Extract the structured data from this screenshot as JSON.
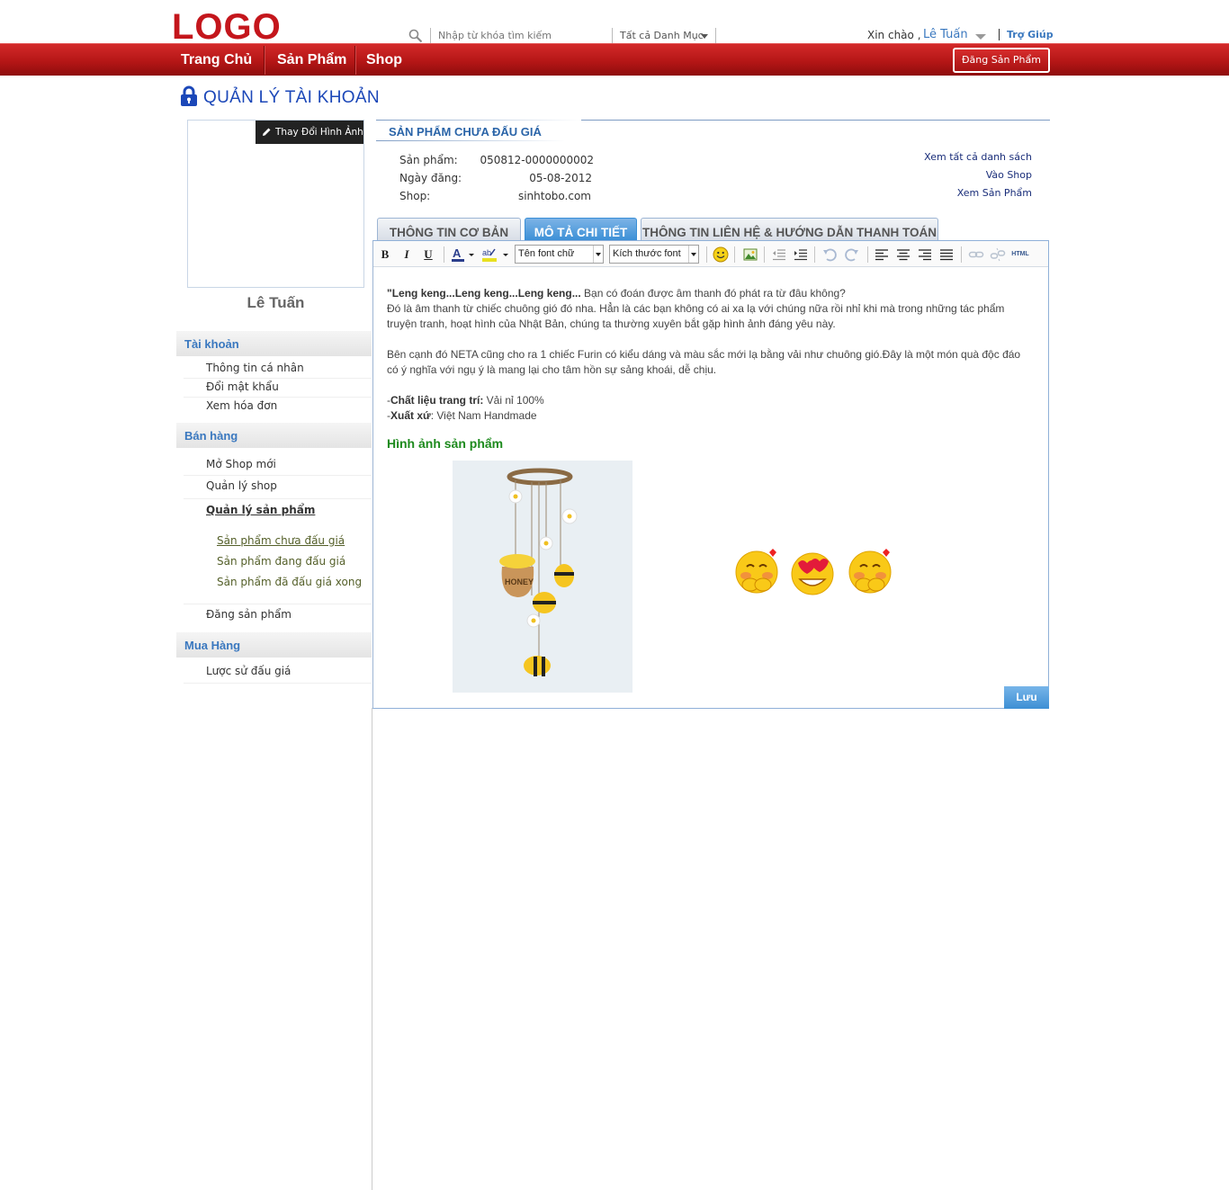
{
  "header": {
    "logo": "LOGO",
    "search_placeholder": "Nhập từ khóa tìm kiếm",
    "category": "Tất cả Danh Mục",
    "greeting": "Xin chào ,",
    "username": "Lê Tuấn",
    "help": "Trợ Giúp"
  },
  "nav": {
    "items": [
      "Trang Chủ",
      "Sản Phẩm",
      "Shop"
    ],
    "post_button": "Đăng Sản Phẩm"
  },
  "page_title": "QUẢN LÝ TÀI KHOẢN",
  "sidebar": {
    "change_photo": "Thay Đổi Hình Ảnh",
    "profile_name": "Lê Tuấn",
    "sections": [
      {
        "title": "Tài khoản",
        "items": [
          "Thông tin cá nhân",
          "Đổi mật khẩu",
          "Xem hóa đơn"
        ]
      },
      {
        "title": "Bán hàng",
        "items": [
          "Mở Shop mới",
          "Quản lý shop",
          "Quản lý sản phẩm",
          "Đăng sản phẩm"
        ],
        "subitems": [
          "Sản phẩm chưa đấu giá",
          "Sản phẩm đang đấu giá",
          "Sản phẩm đã đấu giá xong"
        ]
      },
      {
        "title": "Mua Hàng",
        "items": [
          "Lược sử đấu giá"
        ]
      }
    ]
  },
  "main": {
    "section_title": "SẢN PHẨM CHƯA ĐẤU GIÁ",
    "info": [
      {
        "label": "Sản phẩm:",
        "value": "050812-0000000002"
      },
      {
        "label": "Ngày đăng:",
        "value": "05-08-2012"
      },
      {
        "label": "Shop:",
        "value": "sinhtobo.com"
      }
    ],
    "links": [
      "Xem tất cả danh sách",
      "Vào Shop",
      "Xem Sản Phẩm"
    ],
    "tabs": [
      "THÔNG TIN CƠ BẢN",
      "MÔ TẢ CHI TIẾT",
      "THÔNG TIN LIÊN HỆ & HƯỚNG DẪN THANH TOÁN"
    ],
    "active_tab": "MÔ TẢ CHI TIẾT"
  },
  "editor": {
    "toolbar": {
      "bold": "B",
      "italic": "I",
      "underline": "U",
      "font_name": "Tên font chữ",
      "font_size": "Kích thước font",
      "html": "HTML"
    },
    "p1_bold": "\"Leng keng...Leng keng...Leng keng...",
    "p1_rest": " Bạn có đoán được âm thanh đó phát ra từ đâu không?",
    "p2": "Đó là âm thanh từ chiếc chuông gió đó nha. Hẳn là các bạn không có ai xa lạ với chúng nữa rồi nhỉ khi mà trong những tác phẩm truyện tranh, hoạt hình của Nhật Bản, chúng ta thường xuyên bắt gặp hình ảnh đáng yêu này.",
    "p3": "Bên cạnh đó NETA cũng cho ra  1 chiếc Furin có kiểu dáng và màu sắc mới lạ bằng vải như chuông gió.Đây là một món quà độc đáo có ý nghĩa với ngụ ý là mang lại cho tâm hồn sự sảng khoái, dễ chịu.",
    "material_label": "Chất liệu trang trí:",
    "material_value": " Vải nỉ 100%",
    "origin_label": "Xuất xứ",
    "origin_value": ": Việt Nam Handmade",
    "image_heading": "Hình ảnh sản phẩm",
    "save_button": "Lưu"
  },
  "colors": {
    "brand_red": "#c4161c",
    "nav_red": "#b51616",
    "link_blue": "#3a78bf",
    "title_blue": "#1b47b8",
    "tab_active": "#3a8fd6",
    "heading_green": "#1d8a1d"
  },
  "icons": [
    "search-icon",
    "lock-icon",
    "pencil-icon",
    "emoji-smile-icon",
    "insert-image-icon",
    "undo-icon",
    "redo-icon",
    "link-icon"
  ]
}
